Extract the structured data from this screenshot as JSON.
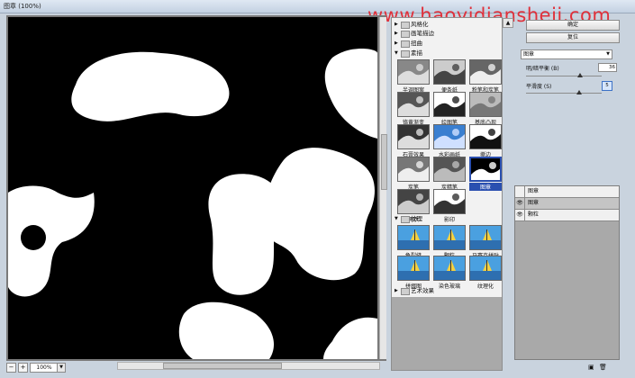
{
  "window": {
    "title": "图章 (100%)"
  },
  "watermark": "www.haoyidiansheji.com",
  "preview": {
    "zoom": "100%",
    "zoom_out": "−",
    "zoom_in": "+"
  },
  "gallery": {
    "categories": [
      {
        "label": "风格化",
        "expanded": false
      },
      {
        "label": "画笔描边",
        "expanded": false
      },
      {
        "label": "扭曲",
        "expanded": false
      },
      {
        "label": "素描",
        "expanded": true
      },
      {
        "label": "纹理",
        "expanded": true
      },
      {
        "label": "艺术效果",
        "expanded": false
      }
    ],
    "sketch_filters": [
      "半调图案",
      "便条纸",
      "粉笔和炭笔",
      "铬黄渐变",
      "绘图笔",
      "基底凸现",
      "石膏效果",
      "水彩画纸",
      "撕边",
      "炭笔",
      "炭精笔",
      "图章",
      "网状",
      "影印"
    ],
    "selected": "图章",
    "texture_filters": [
      "龟裂缝",
      "颗粒",
      "马赛克拼贴",
      "拼缀图",
      "染色玻璃",
      "纹理化"
    ]
  },
  "controls": {
    "ok_label": "确定",
    "reset_label": "复位",
    "filter_select": "图章",
    "param1_label": "明/暗平衡 (B)",
    "param1_value": "36",
    "param1_fraction": 0.72,
    "param2_label": "平滑度 (S)",
    "param2_value": "5",
    "param2_fraction": 0.2
  },
  "layers": {
    "rows": [
      {
        "name": "图章",
        "selected": false,
        "visible": false
      },
      {
        "name": "图章",
        "selected": true,
        "visible": true
      },
      {
        "name": "颗粒",
        "selected": false,
        "visible": true
      }
    ]
  },
  "icons": {
    "new_layer": "new-layer-icon",
    "delete_layer": "trash-icon",
    "eye": "eye-icon"
  }
}
